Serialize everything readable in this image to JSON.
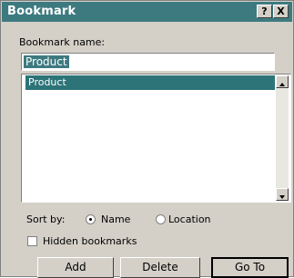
{
  "dialog": {
    "title": "Bookmark",
    "help_label": "?",
    "close_label": "X"
  },
  "form": {
    "name_label": "Bookmark name:",
    "name_value": "Product",
    "list_items": [
      "Product"
    ],
    "sort_label": "Sort by:",
    "sort_options": [
      {
        "label": "Name",
        "selected": true
      },
      {
        "label": "Location",
        "selected": false
      }
    ],
    "hidden_label": "Hidden bookmarks",
    "hidden_checked": false
  },
  "buttons": {
    "add": "Add",
    "delete": "Delete",
    "goto": "Go To"
  },
  "colors": {
    "title_bg": "#3d7a80",
    "selection_bg": "#2c7478",
    "face": "#d4d0c8"
  }
}
